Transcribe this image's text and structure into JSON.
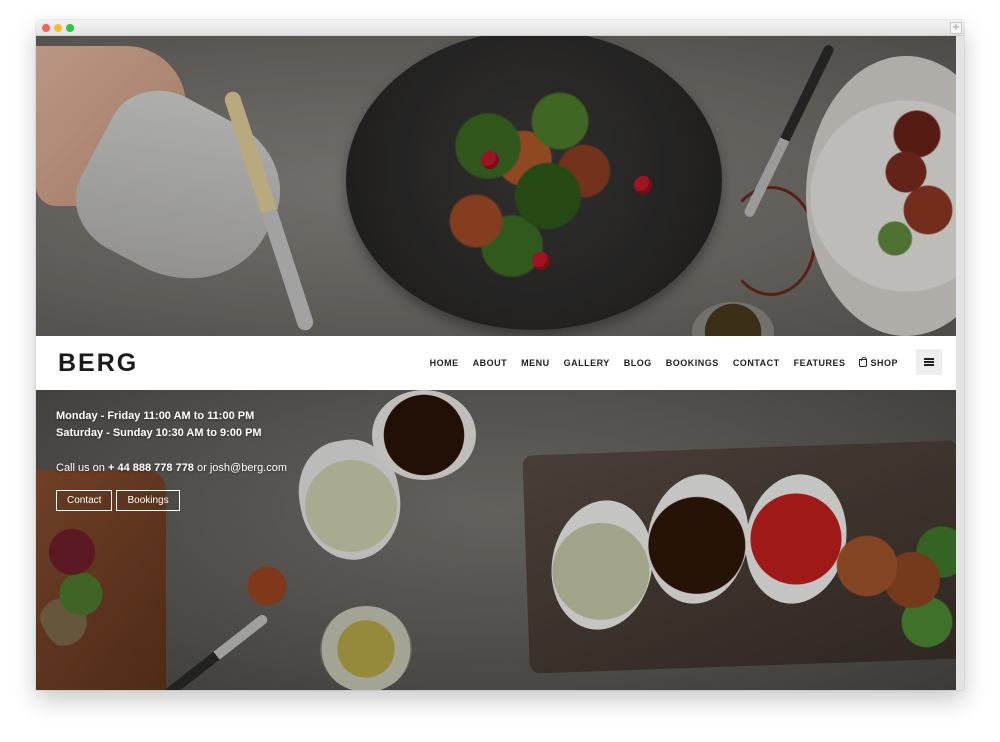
{
  "browser": {
    "expand_glyph": "+"
  },
  "nav": {
    "logo": "BERG",
    "links": [
      {
        "label": "HOME"
      },
      {
        "label": "ABOUT"
      },
      {
        "label": "MENU"
      },
      {
        "label": "GALLERY"
      },
      {
        "label": "BLOG"
      },
      {
        "label": "BOOKINGS"
      },
      {
        "label": "CONTACT"
      },
      {
        "label": "FEATURES"
      },
      {
        "label": "SHOP",
        "icon": "shopping-bag-icon"
      }
    ],
    "menu_icon": "hamburger-icon"
  },
  "hero": {
    "hours": [
      "Monday - Friday 11:00 AM to 11:00 PM",
      "Saturday - Sunday 10:30 AM to 9:00 PM"
    ],
    "call_prefix": "Call us on ",
    "phone": "+ 44 888 778 778",
    "or": " or ",
    "email": "josh@berg.com",
    "buttons": [
      "Contact",
      "Bookings"
    ]
  },
  "colors": {
    "navbar_bg": "#ffffff",
    "text_dark": "#1b1b1b",
    "hero_text": "#ffffff",
    "menu_button_bg": "#eeeeee"
  }
}
